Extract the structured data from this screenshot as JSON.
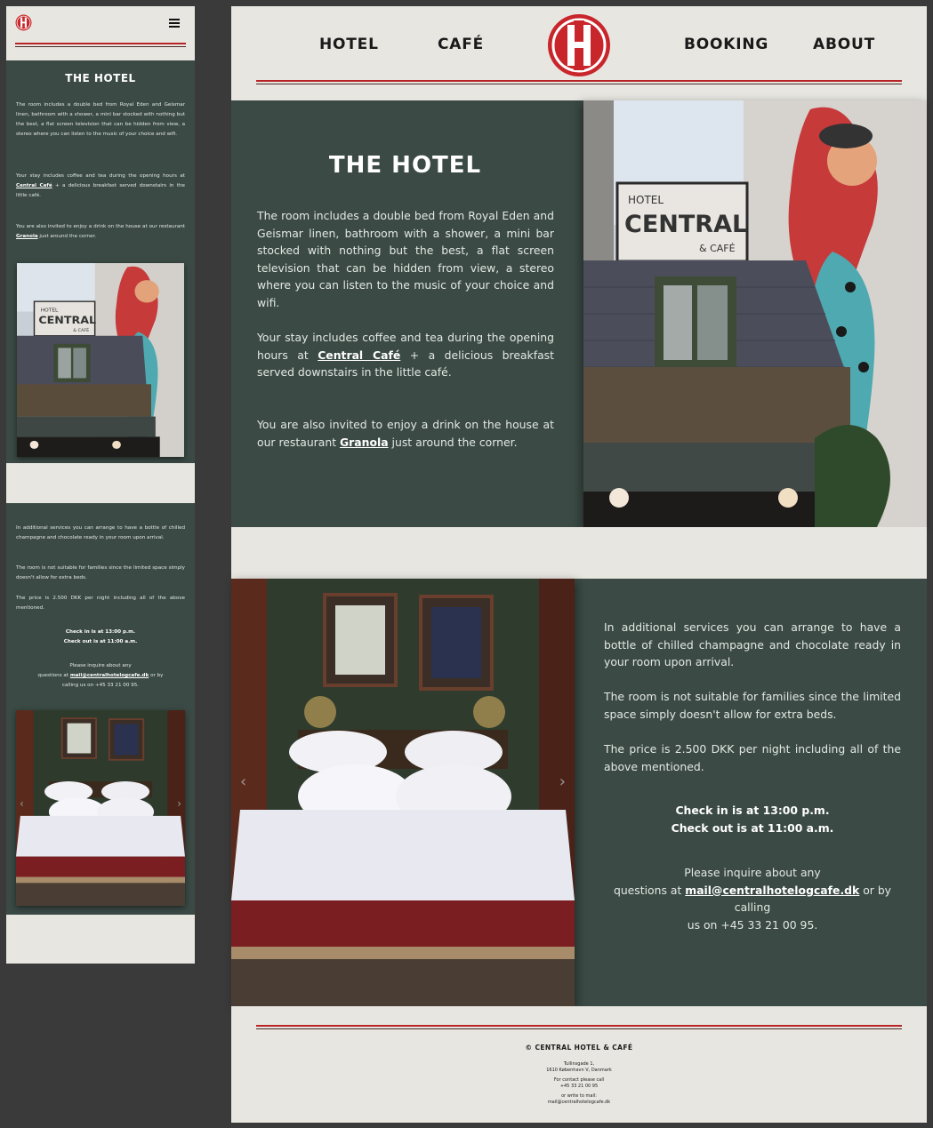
{
  "colors": {
    "accent": "#b82326",
    "panel": "#3b4a45",
    "paper": "#e8e6e0"
  },
  "logo": {
    "letter": "H"
  },
  "nav": {
    "items": [
      "HOTEL",
      "CAFÉ",
      "BOOKING",
      "ABOUT"
    ]
  },
  "mobile_menu_icon": "hamburger-icon",
  "hotel": {
    "title": "THE HOTEL",
    "p1": "The room includes a double bed from Royal Eden and Geismar linen, bathroom with a shower, a mini bar stocked with nothing but the best, a flat screen television that can be hidden from view, a stereo where you can listen to the music of your choice and wifi.",
    "p2_before": "Your stay includes coffee and tea during the opening hours at ",
    "p2_link": "Central Café",
    "p2_after": " + a delicious breakfast served downstairs in the little café.",
    "p3_before": "You are also invited to enjoy a drink on the house at our restaurant ",
    "p3_link": "Granola",
    "p3_after": " just around the corner."
  },
  "sign": {
    "small": "HOTEL",
    "big": "CENTRAL",
    "sub": "& CAFÉ"
  },
  "info": {
    "p1": "In additional services you can arrange to have a bottle of chilled champagne and chocolate ready in your room upon arrival.",
    "p2": "The room is not suitable for families since the limited space simply doesn't allow for extra beds.",
    "p3": "The price is 2.500 DKK per night including all of the above mentioned.",
    "checkin": "Check in is at 13:00 p.m.",
    "checkout": "Check out is at 11:00 a.m.",
    "inquire_1": "Please inquire about any",
    "inquire_2_before": "questions at ",
    "email": "mail@centralhotelogcafe.dk",
    "inquire_2_after": " or by calling",
    "inquire_3": "us on +45 33 21 00 95.",
    "m_inquire_2_after": " or by",
    "m_inquire_3": "calling us on +45 33 21 00 95."
  },
  "carousel": {
    "prev_icon": "chevron-left-icon",
    "next_icon": "chevron-right-icon",
    "prev": "‹",
    "next": "›"
  },
  "footer": {
    "title": "© CENTRAL HOTEL & CAFÉ",
    "address1": "Tullinsgade 1,",
    "address2": "1610 København V, Danmark",
    "contact1": "For contact please call",
    "contact2": "+45 33 21 00 95",
    "mail1": "or write to mail:",
    "mail2": "mail@centralhotelogcafe.dk"
  }
}
